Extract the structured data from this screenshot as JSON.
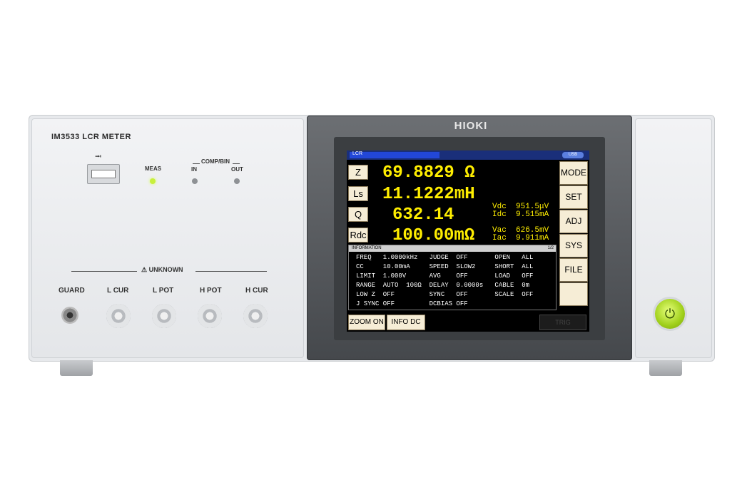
{
  "device": {
    "brand": "HIOKI",
    "model": "IM3533 LCR METER",
    "usb_symbol": "⭲",
    "meas_label": "MEAS",
    "comp_bin_label": "COMP/BIN",
    "in_label": "IN",
    "out_label": "OUT",
    "unknown_label": "⚠ UNKNOWN",
    "terminals": [
      "GUARD",
      "L CUR",
      "L POT",
      "H POT",
      "H CUR"
    ],
    "power_icon": "⏻"
  },
  "screen": {
    "status_label": "LCR",
    "usb_badge": "USB",
    "params": [
      {
        "label": "Z",
        "value": "69.8829 Ω"
      },
      {
        "label": "Ls",
        "value": "11.1222mH"
      },
      {
        "label": "Q",
        "value": "632.14"
      },
      {
        "label": "Rdc",
        "value": "100.00mΩ"
      }
    ],
    "monitor": {
      "vdc": "Vdc  951.5μV",
      "idc": "Idc  9.515mA",
      "vac": "Vac  626.5mV",
      "iac": "Iac  9.911mA"
    },
    "side_buttons": [
      "MODE",
      "SET",
      "ADJ",
      "SYS",
      "FILE",
      ""
    ],
    "info": {
      "header": "INFORMATION",
      "page": "1/2",
      "rows": [
        "FREQ   1.0000kHz   JUDGE  OFF       OPEN   ALL",
        "CC     10.00mA     SPEED  SLOW2     SHORT  ALL",
        "LIMIT  1.000V      AVG    OFF       LOAD   OFF",
        "RANGE  AUTO  100Ω  DELAY  0.0000s   CABLE  0m",
        "LOW Z  OFF         SYNC   OFF       SCALE  OFF",
        "J SYNC OFF         DCBIAS OFF"
      ]
    },
    "bottom_buttons": [
      "ZOOM ON",
      "INFO DC"
    ],
    "trig": "TRIG"
  },
  "colors": {
    "value_yellow": "#ffee00",
    "button_beige": "#f6edd6",
    "status_blue": "#2247d8",
    "led_green": "#c8f03c",
    "power_green": "#9fcf1a"
  }
}
